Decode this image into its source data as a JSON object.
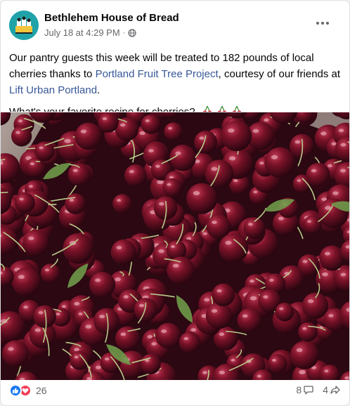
{
  "post": {
    "page_name": "Bethlehem House of Bread",
    "timestamp": "July 18 at 4:29 PM",
    "separator": "·",
    "audience_icon": "globe-icon",
    "text": {
      "part1": "Our pantry guests this week will be treated to 182 pounds of local cherries thanks to ",
      "link1": "Portland Fruit Tree Project",
      "part2": ", courtesy of our friends at ",
      "link2": "Lift Urban Portland",
      "part3": ".",
      "question": "What's your favorite recipe for cherries?"
    },
    "photo_alt_icon": "cherries-photo",
    "reactions": {
      "types": [
        "like",
        "love"
      ],
      "count": "26"
    },
    "comments_count": "8",
    "shares_count": "4"
  },
  "colors": {
    "link": "#385898",
    "like": "#1877f2",
    "love": "#f33e58",
    "avatar_bg": "#1fa3a8",
    "cherry": "#5a0f1f"
  }
}
